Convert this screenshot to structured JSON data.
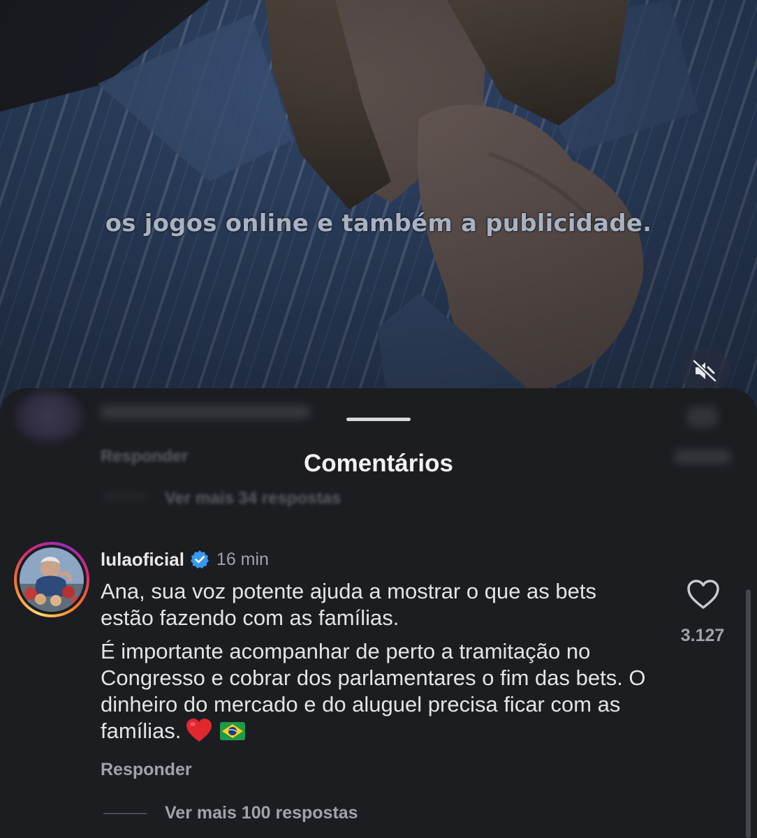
{
  "video": {
    "subtitle": "os jogos online e também a publicidade.",
    "mute_icon": "speaker-muted-icon"
  },
  "comments_sheet": {
    "title": "Comentários",
    "hidden_behind": {
      "reply_label": "Responder",
      "more_replies_label": "Ver mais 34 respostas"
    },
    "comment": {
      "username": "lulaoficial",
      "verified_icon": "verified-badge-icon",
      "timestamp": "16 min",
      "paragraph_1": "Ana, sua voz potente ajuda a mostrar o que as bets estão fazendo com as famílias.",
      "paragraph_2": "É importante acompanhar de perto a tramitação no Congresso e cobrar dos parlamentares o fim das bets. O dinheiro do mercado e do aluguel precisa ficar com as famílias.",
      "reply_label": "Responder",
      "like_icon": "heart-outline-icon",
      "like_count": "3.127",
      "more_replies_label": "Ver mais 100 respostas"
    }
  },
  "colors": {
    "sheet_background": "#1c1d21",
    "primary_text": "#e3e4e6",
    "secondary_text": "#a0a3a8",
    "verified_blue": "#3897f0"
  }
}
